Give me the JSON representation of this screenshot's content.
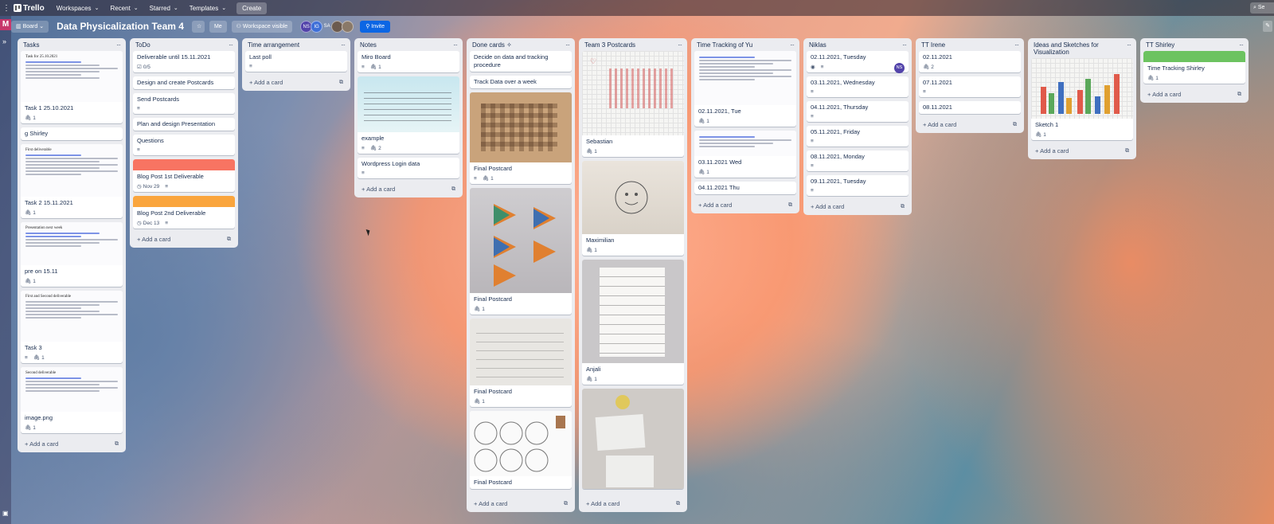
{
  "topbar": {
    "app_name": "Trello",
    "menus": [
      "Workspaces",
      "Recent",
      "Starred",
      "Templates"
    ],
    "create": "Create",
    "search": "Se"
  },
  "workspace_badge": "M",
  "board": {
    "view": "Board",
    "title": "Data Physicalization Team 4",
    "me_filter": "Me",
    "visibility": "Workspace visible",
    "members": [
      {
        "initials": "NS",
        "color": "#5243aa"
      },
      {
        "initials": "IG",
        "color": "#3e6fd8"
      },
      {
        "initials": "SA",
        "color": "transparent"
      },
      {
        "initials": "",
        "color": "#6b5a4e"
      },
      {
        "initials": "",
        "color": "#8a7968"
      }
    ],
    "invite": "Invite"
  },
  "add_card_label": "Add a card",
  "lists": [
    {
      "name": "Tasks",
      "cards": [
        {
          "title": "Task 1 25.10.2021",
          "badges": {
            "attachments": "1"
          }
        },
        {
          "title": "g Shirley"
        },
        {
          "title": "Task 2 15.11.2021",
          "badges": {
            "attachments": "1"
          }
        },
        {
          "title": "pre on 15.11",
          "badges": {
            "attachments": "1"
          }
        },
        {
          "title": "Task 3",
          "badges": {
            "attachments": "1"
          }
        },
        {
          "title": "image.png",
          "badges": {
            "attachments": "1"
          }
        }
      ],
      "docs": [
        "Task for 25.10.2021",
        "First deliverable",
        "Presentation next week",
        "First and Second deliverable",
        "Second deliverable"
      ]
    },
    {
      "name": "ToDo",
      "cards": [
        {
          "title": "Deliverable until 15.11.2021",
          "badges": {
            "checklist": "0/5"
          }
        },
        {
          "title": "Design and create Postcards"
        },
        {
          "title": "Send Postcards"
        },
        {
          "title": "Plan and design Presentation"
        },
        {
          "title": "Questions"
        },
        {
          "title": "Blog Post 1st Deliverable",
          "badges": {
            "due": "Nov 29"
          }
        },
        {
          "title": "Blog Post 2nd Deliverable",
          "badges": {
            "due": "Dec 13"
          }
        }
      ],
      "cover_colors": [
        "#f87462",
        "#faa53d"
      ]
    },
    {
      "name": "Time arrangement",
      "cards": [
        {
          "title": "Last poll"
        }
      ]
    },
    {
      "name": "Notes",
      "cards": [
        {
          "title": "Miro Board",
          "badges": {
            "attachments": "1"
          }
        },
        {
          "title": "example",
          "badges": {
            "attachments": "2"
          }
        },
        {
          "title": "Wordpress Login data"
        }
      ]
    },
    {
      "name": "Done cards",
      "cards": [
        {
          "title": "Decide on data and tracking procedure"
        },
        {
          "title": "Track Data over a week"
        },
        {
          "title": "Final Postcard",
          "badges": {
            "attachments": "1"
          }
        },
        {
          "title": "Final Postcard",
          "badges": {
            "attachments": "1"
          }
        },
        {
          "title": "Final Postcard",
          "badges": {
            "attachments": "1"
          }
        },
        {
          "title": "Final Postcard"
        }
      ]
    },
    {
      "name": "Team 3 Postcards",
      "cards": [
        {
          "title": "Sebastian",
          "badges": {
            "attachments": "1"
          }
        },
        {
          "title": "Maximilian",
          "badges": {
            "attachments": "1"
          }
        },
        {
          "title": "Anjali",
          "badges": {
            "attachments": "1"
          }
        },
        {
          "title": ""
        }
      ]
    },
    {
      "name": "Time Tracking of Yu",
      "cards": [
        {
          "title": "02.11.2021, Tue",
          "badges": {
            "attachments": "1"
          }
        },
        {
          "title": "03.11.2021 Wed",
          "badges": {
            "attachments": "1"
          }
        },
        {
          "title": "04.11.2021 Thu"
        }
      ]
    },
    {
      "name": "Niklas",
      "cards": [
        {
          "title": "02.11.2021, Tuesday",
          "member": "NS"
        },
        {
          "title": "03.11.2021, Wednesday"
        },
        {
          "title": "04.11.2021, Thursday"
        },
        {
          "title": "05.11.2021, Friday"
        },
        {
          "title": "08.11.2021, Monday"
        },
        {
          "title": "09.11.2021, Tuesday"
        }
      ]
    },
    {
      "name": "TT Irene",
      "cards": [
        {
          "title": "02.11.2021",
          "badges": {
            "attachments": "2"
          }
        },
        {
          "title": "07.11.2021"
        },
        {
          "title": "08.11.2021"
        }
      ]
    },
    {
      "name": "Ideas and Sketches for Visualization",
      "cards": [
        {
          "title": "Sketch 1",
          "badges": {
            "attachments": "1"
          }
        }
      ]
    },
    {
      "name": "TT Shirley",
      "cards": [
        {
          "title": "Time Tracking Shirley",
          "badges": {
            "attachments": "1"
          }
        }
      ],
      "cover_colors": [
        "#6cc360"
      ]
    }
  ],
  "icons": {
    "attachment": "paperclip-icon",
    "description": "description-icon",
    "checklist": "checklist-icon",
    "due": "clock-icon",
    "watch": "eye-icon",
    "template": "card-template-icon"
  }
}
